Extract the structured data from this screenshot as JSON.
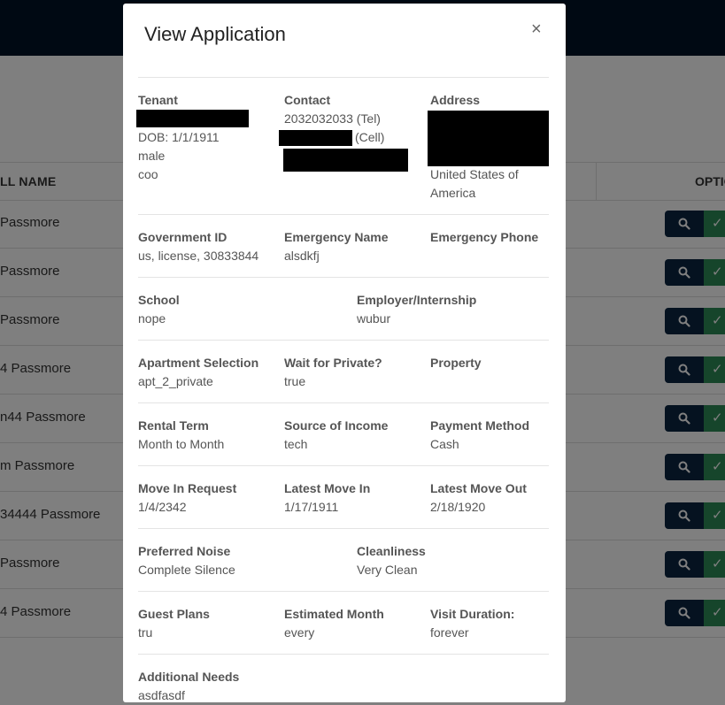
{
  "table": {
    "name_header": "LL NAME",
    "options_header": "OPTIO",
    "rows": [
      {
        "name": "Passmore"
      },
      {
        "name": "Passmore"
      },
      {
        "name": "Passmore"
      },
      {
        "name": "4 Passmore"
      },
      {
        "name": "n44 Passmore"
      },
      {
        "name": "m Passmore"
      },
      {
        "name": "34444 Passmore"
      },
      {
        "name": "Passmore"
      },
      {
        "name": "4 Passmore"
      }
    ]
  },
  "modal": {
    "title": "View Application",
    "close_label": "×",
    "tenant": {
      "label": "Tenant",
      "dob": "DOB: 1/1/1911",
      "gender": "male",
      "extra": "coo"
    },
    "contact": {
      "label": "Contact",
      "tel": "2032032033 (Tel)",
      "cell_suffix": "(Cell)"
    },
    "address": {
      "label": "Address",
      "country_line1": "United States of",
      "country_line2": "America"
    },
    "government_id": {
      "label": "Government ID",
      "value": "us, license, 30833844"
    },
    "emergency_name": {
      "label": "Emergency Name",
      "value": "alsdkfj"
    },
    "emergency_phone": {
      "label": "Emergency Phone",
      "value": ""
    },
    "school": {
      "label": "School",
      "value": "nope"
    },
    "employer": {
      "label": "Employer/Internship",
      "value": "wubur"
    },
    "apartment_selection": {
      "label": "Apartment Selection",
      "value": "apt_2_private"
    },
    "wait_for_private": {
      "label": "Wait for Private?",
      "value": "true"
    },
    "property": {
      "label": "Property",
      "value": ""
    },
    "rental_term": {
      "label": "Rental Term",
      "value": "Month to Month"
    },
    "source_of_income": {
      "label": "Source of Income",
      "value": "tech"
    },
    "payment_method": {
      "label": "Payment Method",
      "value": "Cash"
    },
    "move_in_request": {
      "label": "Move In Request",
      "value": "1/4/2342"
    },
    "latest_move_in": {
      "label": "Latest Move In",
      "value": "1/17/1911"
    },
    "latest_move_out": {
      "label": "Latest Move Out",
      "value": "2/18/1920"
    },
    "preferred_noise": {
      "label": "Preferred Noise",
      "value": "Complete Silence"
    },
    "cleanliness": {
      "label": "Cleanliness",
      "value": "Very Clean"
    },
    "guest_plans": {
      "label": "Guest Plans",
      "value": "tru"
    },
    "estimated_month": {
      "label": "Estimated Month",
      "value": "every"
    },
    "visit_duration": {
      "label": "Visit Duration:",
      "value": "forever"
    },
    "additional_needs": {
      "label": "Additional Needs",
      "value": "asdfasdf"
    }
  },
  "colors": {
    "navbar": "#011326",
    "view_button": "#0a2440",
    "approve_button": "#2c8a57"
  },
  "icons": {
    "view": "search-icon",
    "approve": "check-icon",
    "close": "close-icon"
  }
}
